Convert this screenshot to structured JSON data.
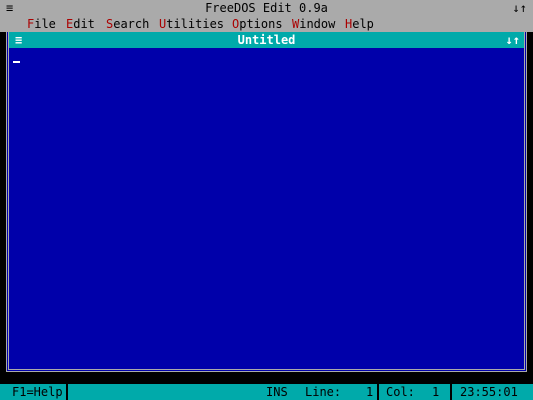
{
  "titlebar": {
    "system_menu_icon": "≡",
    "title": "FreeDOS Edit 0.9a",
    "resize_icon": "↓↑"
  },
  "menubar": {
    "items": [
      {
        "hotkey": "F",
        "rest": "ile"
      },
      {
        "hotkey": "E",
        "rest": "dit"
      },
      {
        "hotkey": "S",
        "rest": "earch"
      },
      {
        "hotkey": "U",
        "rest": "tilities"
      },
      {
        "hotkey": "O",
        "rest": "ptions"
      },
      {
        "hotkey": "W",
        "rest": "indow"
      },
      {
        "hotkey": "H",
        "rest": "elp"
      }
    ]
  },
  "window": {
    "system_icon": "≡",
    "title": "Untitled",
    "zoom_icon": "↓↑"
  },
  "statusbar": {
    "help": "F1=Help",
    "mode": "INS",
    "line_label": "Line:",
    "line_value": "1",
    "col_label": "Col:",
    "col_value": "1",
    "clock": "23:55:01"
  },
  "colors": {
    "desktop_gray": "#aaaaaa",
    "hotkey_red": "#aa0000",
    "editor_blue": "#0000aa",
    "title_cyan": "#00aaaa",
    "text_white": "#ffffff"
  }
}
